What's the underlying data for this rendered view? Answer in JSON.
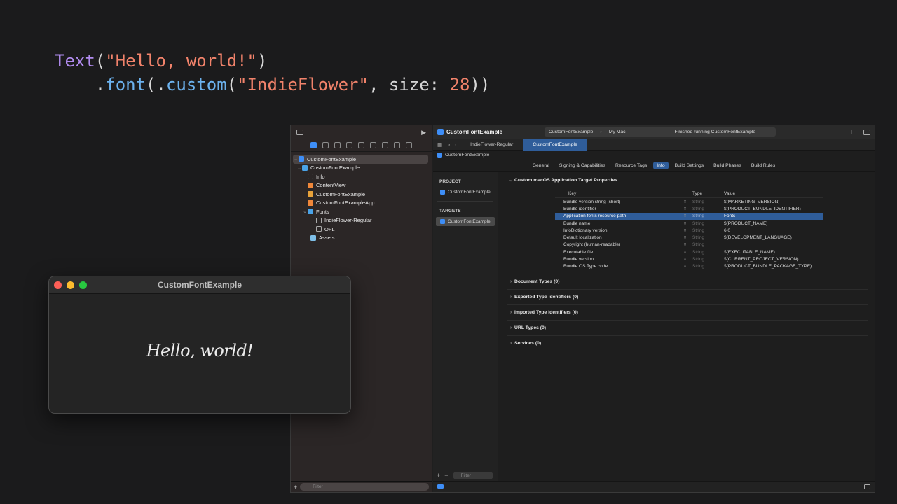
{
  "code": {
    "line1": {
      "kw": "Text",
      "open": "(",
      "str": "\"Hello, world!\"",
      "close": ")"
    },
    "line2": {
      "dot": ".",
      "fn1": "font",
      "open": "(.",
      "fn2": "custom",
      "open2": "(",
      "str": "\"IndieFlower\"",
      "comma": ", size: ",
      "num": "28",
      "close": "))"
    }
  },
  "xcode": {
    "navigator": {
      "items": [
        {
          "label": "CustomFontExample",
          "icon": "app-icon"
        },
        {
          "label": "CustomFontExample",
          "icon": "folder-icon"
        },
        {
          "label": "Info",
          "icon": "list-icon"
        },
        {
          "label": "ContentView",
          "icon": "swift-icon"
        },
        {
          "label": "CustomFontExample",
          "icon": "entitlements-icon"
        },
        {
          "label": "CustomFontExampleApp",
          "icon": "swift-icon"
        },
        {
          "label": "Fonts",
          "icon": "folder-icon"
        },
        {
          "label": "IndieFlower-Regular",
          "icon": "file-icon"
        },
        {
          "label": "OFL",
          "icon": "file-icon"
        },
        {
          "label": "Assets",
          "icon": "assets-icon"
        }
      ],
      "filter_placeholder": "Filter"
    },
    "toolbar": {
      "title": "CustomFontExample",
      "scheme": "CustomFontExample",
      "destination": "My Mac",
      "status": "Finished running CustomFontExample"
    },
    "tabs": [
      "IndieFlower-Regular",
      "CustomFontExample"
    ],
    "breadcrumb": "CustomFontExample",
    "segments": [
      "General",
      "Signing & Capabilities",
      "Resource Tags",
      "Info",
      "Build Settings",
      "Build Phases",
      "Build Rules"
    ],
    "project_pane": {
      "project_header": "PROJECT",
      "project_item": "CustomFontExample",
      "targets_header": "TARGETS",
      "target_item": "CustomFontExample",
      "filter_placeholder": "Filter"
    },
    "properties": {
      "section_title": "Custom macOS Application Target Properties",
      "columns": {
        "key": "Key",
        "type": "Type",
        "value": "Value"
      },
      "rows": [
        {
          "key": "Bundle version string (short)",
          "type": "String",
          "value": "$(MARKETING_VERSION)"
        },
        {
          "key": "Bundle identifier",
          "type": "String",
          "value": "$(PRODUCT_BUNDLE_IDENTIFIER)"
        },
        {
          "key": "Application fonts resource path",
          "type": "String",
          "value": "Fonts"
        },
        {
          "key": "Bundle name",
          "type": "String",
          "value": "$(PRODUCT_NAME)"
        },
        {
          "key": "InfoDictionary version",
          "type": "String",
          "value": "6.0"
        },
        {
          "key": "Default localization",
          "type": "String",
          "value": "$(DEVELOPMENT_LANGUAGE)"
        },
        {
          "key": "Copyright (human-readable)",
          "type": "String",
          "value": ""
        },
        {
          "key": "Executable file",
          "type": "String",
          "value": "$(EXECUTABLE_NAME)"
        },
        {
          "key": "Bundle version",
          "type": "String",
          "value": "$(CURRENT_PROJECT_VERSION)"
        },
        {
          "key": "Bundle OS Type code",
          "type": "String",
          "value": "$(PRODUCT_BUNDLE_PACKAGE_TYPE)"
        }
      ],
      "selected_row": 2,
      "collapsed_sections": [
        "Document Types (0)",
        "Exported Type Identifiers (0)",
        "Imported Type Identifiers (0)",
        "URL Types (0)",
        "Services (0)"
      ]
    }
  },
  "app_window": {
    "title": "CustomFontExample",
    "content": "Hello, world!"
  },
  "colors": {
    "accent": "#2f5d9a",
    "keyword": "#b28cf0",
    "string": "#f2836b",
    "function": "#6cb2ee"
  }
}
